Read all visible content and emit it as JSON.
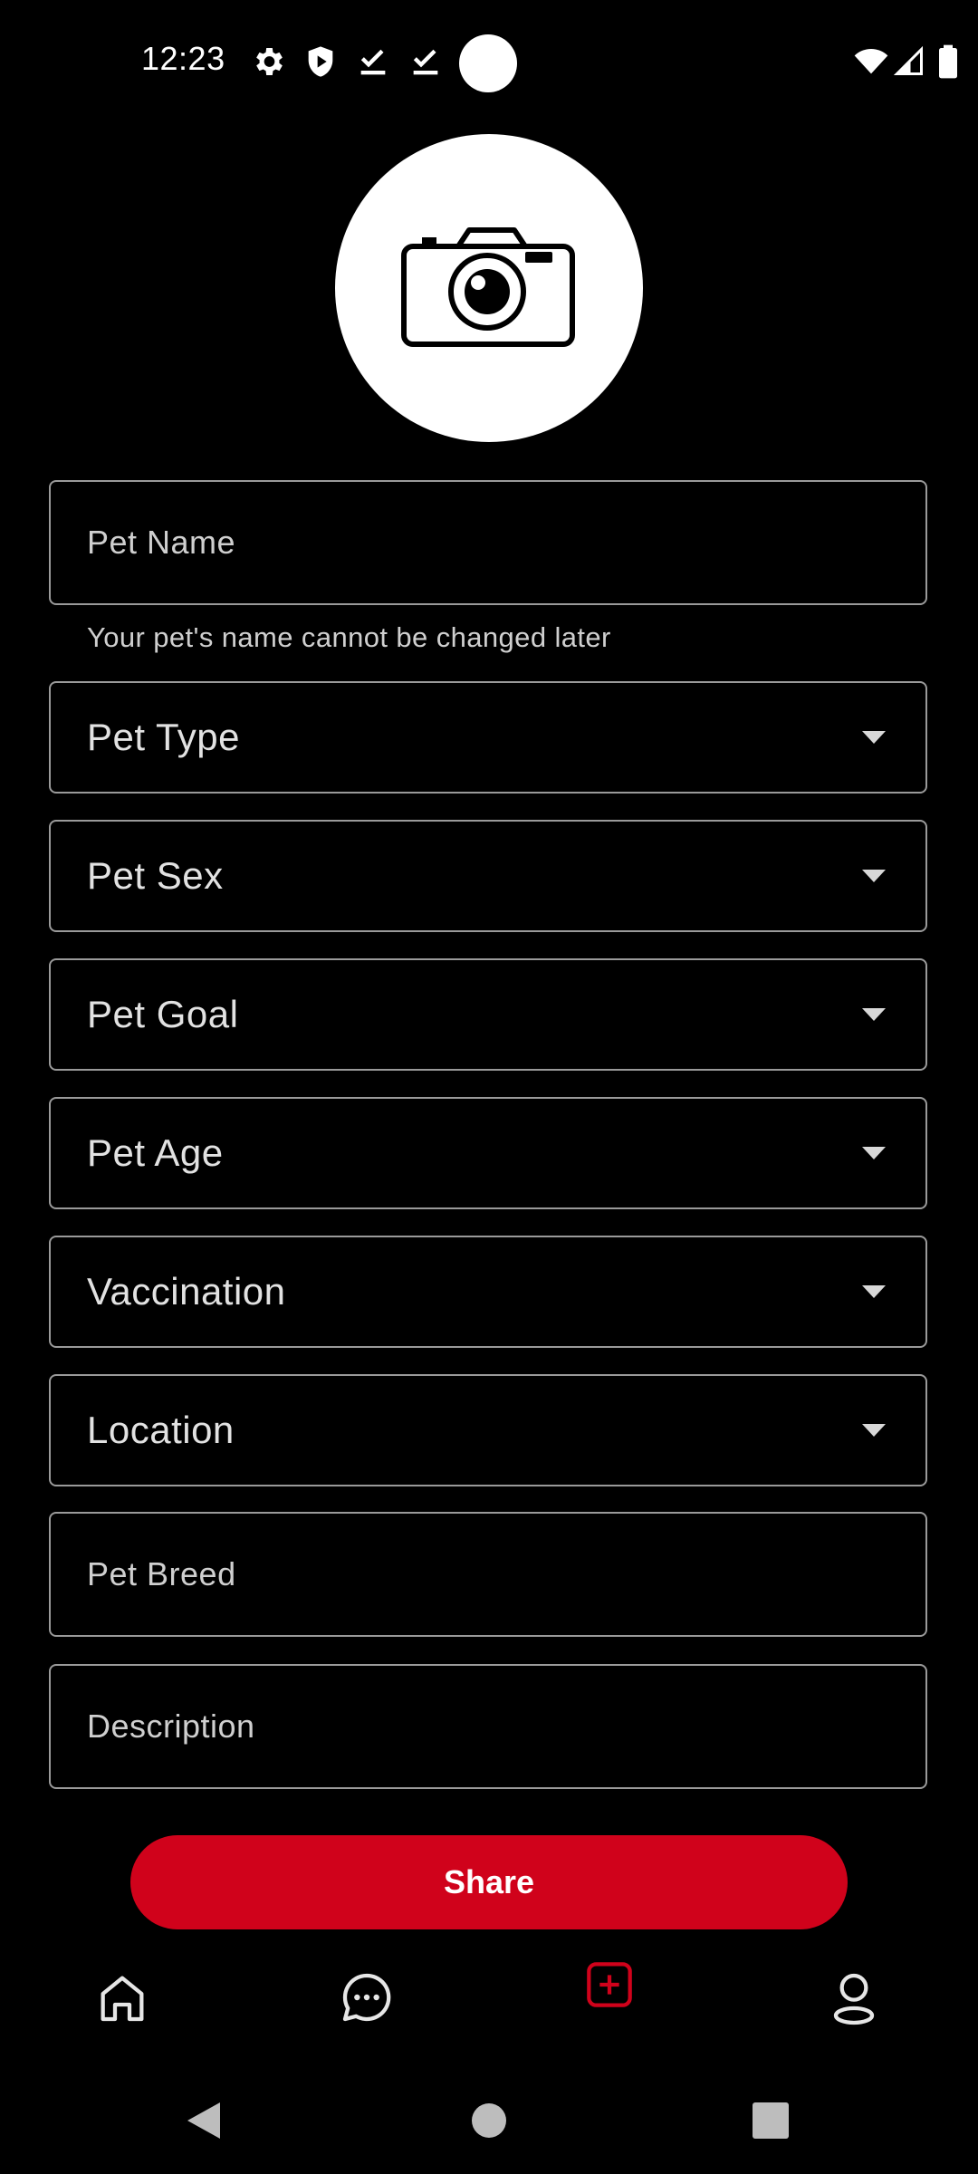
{
  "status_bar": {
    "time": "12:23",
    "icons_left": [
      "gear-icon",
      "shield-icon",
      "download-done-icon",
      "download-done-icon"
    ],
    "icons_right": [
      "wifi-icon",
      "signal-icon",
      "battery-icon"
    ]
  },
  "photo": {
    "icon": "camera-icon"
  },
  "form": {
    "pet_name": {
      "placeholder": "Pet Name",
      "helper": "Your pet's name cannot be changed later"
    },
    "pet_type": {
      "label": "Pet Type"
    },
    "pet_sex": {
      "label": "Pet Sex"
    },
    "pet_goal": {
      "label": "Pet Goal"
    },
    "pet_age": {
      "label": "Pet Age"
    },
    "vaccination": {
      "label": "Vaccination"
    },
    "location": {
      "label": "Location"
    },
    "pet_breed": {
      "placeholder": "Pet Breed"
    },
    "description": {
      "placeholder": "Description"
    }
  },
  "share_button": {
    "label": "Share"
  },
  "bottom_nav": {
    "items": [
      {
        "name": "home",
        "icon": "home-icon"
      },
      {
        "name": "messages",
        "icon": "chat-icon"
      },
      {
        "name": "add-post",
        "icon": "add-box-icon",
        "active": true
      },
      {
        "name": "profile",
        "icon": "profile-icon"
      }
    ]
  },
  "colors": {
    "accent": "#d0021b",
    "background": "#000000",
    "border": "#9a9a9a"
  }
}
